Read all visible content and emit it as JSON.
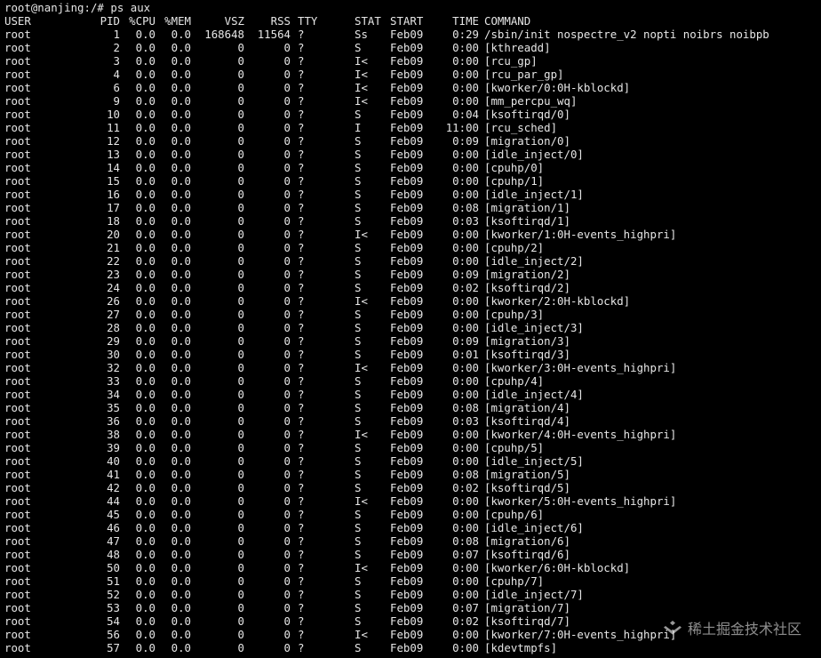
{
  "prompt": {
    "text": "root@nanjing:/# ps aux"
  },
  "header": {
    "user": "USER",
    "pid": "PID",
    "cpu": "%CPU",
    "mem": "%MEM",
    "vsz": "VSZ",
    "rss": "RSS",
    "tty": "TTY",
    "stat": "STAT",
    "start": "START",
    "time": "TIME",
    "command": "COMMAND"
  },
  "rows": [
    {
      "user": "root",
      "pid": "1",
      "cpu": "0.0",
      "mem": "0.0",
      "vsz": "168648",
      "rss": "11564",
      "tty": "?",
      "stat": "Ss",
      "start": "Feb09",
      "time": "0:29",
      "command": "/sbin/init nospectre_v2 nopti noibrs noibpb"
    },
    {
      "user": "root",
      "pid": "2",
      "cpu": "0.0",
      "mem": "0.0",
      "vsz": "0",
      "rss": "0",
      "tty": "?",
      "stat": "S",
      "start": "Feb09",
      "time": "0:00",
      "command": "[kthreadd]"
    },
    {
      "user": "root",
      "pid": "3",
      "cpu": "0.0",
      "mem": "0.0",
      "vsz": "0",
      "rss": "0",
      "tty": "?",
      "stat": "I<",
      "start": "Feb09",
      "time": "0:00",
      "command": "[rcu_gp]"
    },
    {
      "user": "root",
      "pid": "4",
      "cpu": "0.0",
      "mem": "0.0",
      "vsz": "0",
      "rss": "0",
      "tty": "?",
      "stat": "I<",
      "start": "Feb09",
      "time": "0:00",
      "command": "[rcu_par_gp]"
    },
    {
      "user": "root",
      "pid": "6",
      "cpu": "0.0",
      "mem": "0.0",
      "vsz": "0",
      "rss": "0",
      "tty": "?",
      "stat": "I<",
      "start": "Feb09",
      "time": "0:00",
      "command": "[kworker/0:0H-kblockd]"
    },
    {
      "user": "root",
      "pid": "9",
      "cpu": "0.0",
      "mem": "0.0",
      "vsz": "0",
      "rss": "0",
      "tty": "?",
      "stat": "I<",
      "start": "Feb09",
      "time": "0:00",
      "command": "[mm_percpu_wq]"
    },
    {
      "user": "root",
      "pid": "10",
      "cpu": "0.0",
      "mem": "0.0",
      "vsz": "0",
      "rss": "0",
      "tty": "?",
      "stat": "S",
      "start": "Feb09",
      "time": "0:04",
      "command": "[ksoftirqd/0]"
    },
    {
      "user": "root",
      "pid": "11",
      "cpu": "0.0",
      "mem": "0.0",
      "vsz": "0",
      "rss": "0",
      "tty": "?",
      "stat": "I",
      "start": "Feb09",
      "time": "11:00",
      "command": "[rcu_sched]"
    },
    {
      "user": "root",
      "pid": "12",
      "cpu": "0.0",
      "mem": "0.0",
      "vsz": "0",
      "rss": "0",
      "tty": "?",
      "stat": "S",
      "start": "Feb09",
      "time": "0:09",
      "command": "[migration/0]"
    },
    {
      "user": "root",
      "pid": "13",
      "cpu": "0.0",
      "mem": "0.0",
      "vsz": "0",
      "rss": "0",
      "tty": "?",
      "stat": "S",
      "start": "Feb09",
      "time": "0:00",
      "command": "[idle_inject/0]"
    },
    {
      "user": "root",
      "pid": "14",
      "cpu": "0.0",
      "mem": "0.0",
      "vsz": "0",
      "rss": "0",
      "tty": "?",
      "stat": "S",
      "start": "Feb09",
      "time": "0:00",
      "command": "[cpuhp/0]"
    },
    {
      "user": "root",
      "pid": "15",
      "cpu": "0.0",
      "mem": "0.0",
      "vsz": "0",
      "rss": "0",
      "tty": "?",
      "stat": "S",
      "start": "Feb09",
      "time": "0:00",
      "command": "[cpuhp/1]"
    },
    {
      "user": "root",
      "pid": "16",
      "cpu": "0.0",
      "mem": "0.0",
      "vsz": "0",
      "rss": "0",
      "tty": "?",
      "stat": "S",
      "start": "Feb09",
      "time": "0:00",
      "command": "[idle_inject/1]"
    },
    {
      "user": "root",
      "pid": "17",
      "cpu": "0.0",
      "mem": "0.0",
      "vsz": "0",
      "rss": "0",
      "tty": "?",
      "stat": "S",
      "start": "Feb09",
      "time": "0:08",
      "command": "[migration/1]"
    },
    {
      "user": "root",
      "pid": "18",
      "cpu": "0.0",
      "mem": "0.0",
      "vsz": "0",
      "rss": "0",
      "tty": "?",
      "stat": "S",
      "start": "Feb09",
      "time": "0:03",
      "command": "[ksoftirqd/1]"
    },
    {
      "user": "root",
      "pid": "20",
      "cpu": "0.0",
      "mem": "0.0",
      "vsz": "0",
      "rss": "0",
      "tty": "?",
      "stat": "I<",
      "start": "Feb09",
      "time": "0:00",
      "command": "[kworker/1:0H-events_highpri]"
    },
    {
      "user": "root",
      "pid": "21",
      "cpu": "0.0",
      "mem": "0.0",
      "vsz": "0",
      "rss": "0",
      "tty": "?",
      "stat": "S",
      "start": "Feb09",
      "time": "0:00",
      "command": "[cpuhp/2]"
    },
    {
      "user": "root",
      "pid": "22",
      "cpu": "0.0",
      "mem": "0.0",
      "vsz": "0",
      "rss": "0",
      "tty": "?",
      "stat": "S",
      "start": "Feb09",
      "time": "0:00",
      "command": "[idle_inject/2]"
    },
    {
      "user": "root",
      "pid": "23",
      "cpu": "0.0",
      "mem": "0.0",
      "vsz": "0",
      "rss": "0",
      "tty": "?",
      "stat": "S",
      "start": "Feb09",
      "time": "0:09",
      "command": "[migration/2]"
    },
    {
      "user": "root",
      "pid": "24",
      "cpu": "0.0",
      "mem": "0.0",
      "vsz": "0",
      "rss": "0",
      "tty": "?",
      "stat": "S",
      "start": "Feb09",
      "time": "0:02",
      "command": "[ksoftirqd/2]"
    },
    {
      "user": "root",
      "pid": "26",
      "cpu": "0.0",
      "mem": "0.0",
      "vsz": "0",
      "rss": "0",
      "tty": "?",
      "stat": "I<",
      "start": "Feb09",
      "time": "0:00",
      "command": "[kworker/2:0H-kblockd]"
    },
    {
      "user": "root",
      "pid": "27",
      "cpu": "0.0",
      "mem": "0.0",
      "vsz": "0",
      "rss": "0",
      "tty": "?",
      "stat": "S",
      "start": "Feb09",
      "time": "0:00",
      "command": "[cpuhp/3]"
    },
    {
      "user": "root",
      "pid": "28",
      "cpu": "0.0",
      "mem": "0.0",
      "vsz": "0",
      "rss": "0",
      "tty": "?",
      "stat": "S",
      "start": "Feb09",
      "time": "0:00",
      "command": "[idle_inject/3]"
    },
    {
      "user": "root",
      "pid": "29",
      "cpu": "0.0",
      "mem": "0.0",
      "vsz": "0",
      "rss": "0",
      "tty": "?",
      "stat": "S",
      "start": "Feb09",
      "time": "0:09",
      "command": "[migration/3]"
    },
    {
      "user": "root",
      "pid": "30",
      "cpu": "0.0",
      "mem": "0.0",
      "vsz": "0",
      "rss": "0",
      "tty": "?",
      "stat": "S",
      "start": "Feb09",
      "time": "0:01",
      "command": "[ksoftirqd/3]"
    },
    {
      "user": "root",
      "pid": "32",
      "cpu": "0.0",
      "mem": "0.0",
      "vsz": "0",
      "rss": "0",
      "tty": "?",
      "stat": "I<",
      "start": "Feb09",
      "time": "0:00",
      "command": "[kworker/3:0H-events_highpri]"
    },
    {
      "user": "root",
      "pid": "33",
      "cpu": "0.0",
      "mem": "0.0",
      "vsz": "0",
      "rss": "0",
      "tty": "?",
      "stat": "S",
      "start": "Feb09",
      "time": "0:00",
      "command": "[cpuhp/4]"
    },
    {
      "user": "root",
      "pid": "34",
      "cpu": "0.0",
      "mem": "0.0",
      "vsz": "0",
      "rss": "0",
      "tty": "?",
      "stat": "S",
      "start": "Feb09",
      "time": "0:00",
      "command": "[idle_inject/4]"
    },
    {
      "user": "root",
      "pid": "35",
      "cpu": "0.0",
      "mem": "0.0",
      "vsz": "0",
      "rss": "0",
      "tty": "?",
      "stat": "S",
      "start": "Feb09",
      "time": "0:08",
      "command": "[migration/4]"
    },
    {
      "user": "root",
      "pid": "36",
      "cpu": "0.0",
      "mem": "0.0",
      "vsz": "0",
      "rss": "0",
      "tty": "?",
      "stat": "S",
      "start": "Feb09",
      "time": "0:03",
      "command": "[ksoftirqd/4]"
    },
    {
      "user": "root",
      "pid": "38",
      "cpu": "0.0",
      "mem": "0.0",
      "vsz": "0",
      "rss": "0",
      "tty": "?",
      "stat": "I<",
      "start": "Feb09",
      "time": "0:00",
      "command": "[kworker/4:0H-events_highpri]"
    },
    {
      "user": "root",
      "pid": "39",
      "cpu": "0.0",
      "mem": "0.0",
      "vsz": "0",
      "rss": "0",
      "tty": "?",
      "stat": "S",
      "start": "Feb09",
      "time": "0:00",
      "command": "[cpuhp/5]"
    },
    {
      "user": "root",
      "pid": "40",
      "cpu": "0.0",
      "mem": "0.0",
      "vsz": "0",
      "rss": "0",
      "tty": "?",
      "stat": "S",
      "start": "Feb09",
      "time": "0:00",
      "command": "[idle_inject/5]"
    },
    {
      "user": "root",
      "pid": "41",
      "cpu": "0.0",
      "mem": "0.0",
      "vsz": "0",
      "rss": "0",
      "tty": "?",
      "stat": "S",
      "start": "Feb09",
      "time": "0:08",
      "command": "[migration/5]"
    },
    {
      "user": "root",
      "pid": "42",
      "cpu": "0.0",
      "mem": "0.0",
      "vsz": "0",
      "rss": "0",
      "tty": "?",
      "stat": "S",
      "start": "Feb09",
      "time": "0:02",
      "command": "[ksoftirqd/5]"
    },
    {
      "user": "root",
      "pid": "44",
      "cpu": "0.0",
      "mem": "0.0",
      "vsz": "0",
      "rss": "0",
      "tty": "?",
      "stat": "I<",
      "start": "Feb09",
      "time": "0:00",
      "command": "[kworker/5:0H-events_highpri]"
    },
    {
      "user": "root",
      "pid": "45",
      "cpu": "0.0",
      "mem": "0.0",
      "vsz": "0",
      "rss": "0",
      "tty": "?",
      "stat": "S",
      "start": "Feb09",
      "time": "0:00",
      "command": "[cpuhp/6]"
    },
    {
      "user": "root",
      "pid": "46",
      "cpu": "0.0",
      "mem": "0.0",
      "vsz": "0",
      "rss": "0",
      "tty": "?",
      "stat": "S",
      "start": "Feb09",
      "time": "0:00",
      "command": "[idle_inject/6]"
    },
    {
      "user": "root",
      "pid": "47",
      "cpu": "0.0",
      "mem": "0.0",
      "vsz": "0",
      "rss": "0",
      "tty": "?",
      "stat": "S",
      "start": "Feb09",
      "time": "0:08",
      "command": "[migration/6]"
    },
    {
      "user": "root",
      "pid": "48",
      "cpu": "0.0",
      "mem": "0.0",
      "vsz": "0",
      "rss": "0",
      "tty": "?",
      "stat": "S",
      "start": "Feb09",
      "time": "0:07",
      "command": "[ksoftirqd/6]"
    },
    {
      "user": "root",
      "pid": "50",
      "cpu": "0.0",
      "mem": "0.0",
      "vsz": "0",
      "rss": "0",
      "tty": "?",
      "stat": "I<",
      "start": "Feb09",
      "time": "0:00",
      "command": "[kworker/6:0H-kblockd]"
    },
    {
      "user": "root",
      "pid": "51",
      "cpu": "0.0",
      "mem": "0.0",
      "vsz": "0",
      "rss": "0",
      "tty": "?",
      "stat": "S",
      "start": "Feb09",
      "time": "0:00",
      "command": "[cpuhp/7]"
    },
    {
      "user": "root",
      "pid": "52",
      "cpu": "0.0",
      "mem": "0.0",
      "vsz": "0",
      "rss": "0",
      "tty": "?",
      "stat": "S",
      "start": "Feb09",
      "time": "0:00",
      "command": "[idle_inject/7]"
    },
    {
      "user": "root",
      "pid": "53",
      "cpu": "0.0",
      "mem": "0.0",
      "vsz": "0",
      "rss": "0",
      "tty": "?",
      "stat": "S",
      "start": "Feb09",
      "time": "0:07",
      "command": "[migration/7]"
    },
    {
      "user": "root",
      "pid": "54",
      "cpu": "0.0",
      "mem": "0.0",
      "vsz": "0",
      "rss": "0",
      "tty": "?",
      "stat": "S",
      "start": "Feb09",
      "time": "0:02",
      "command": "[ksoftirqd/7]"
    },
    {
      "user": "root",
      "pid": "56",
      "cpu": "0.0",
      "mem": "0.0",
      "vsz": "0",
      "rss": "0",
      "tty": "?",
      "stat": "I<",
      "start": "Feb09",
      "time": "0:00",
      "command": "[kworker/7:0H-events_highpri]"
    },
    {
      "user": "root",
      "pid": "57",
      "cpu": "0.0",
      "mem": "0.0",
      "vsz": "0",
      "rss": "0",
      "tty": "?",
      "stat": "S",
      "start": "Feb09",
      "time": "0:00",
      "command": "[kdevtmpfs]"
    }
  ],
  "watermark": {
    "text": "稀土掘金技术社区",
    "logo_icon": "juejin-logo-icon"
  },
  "colors": {
    "background": "#000000",
    "foreground": "#e6e6e6"
  }
}
